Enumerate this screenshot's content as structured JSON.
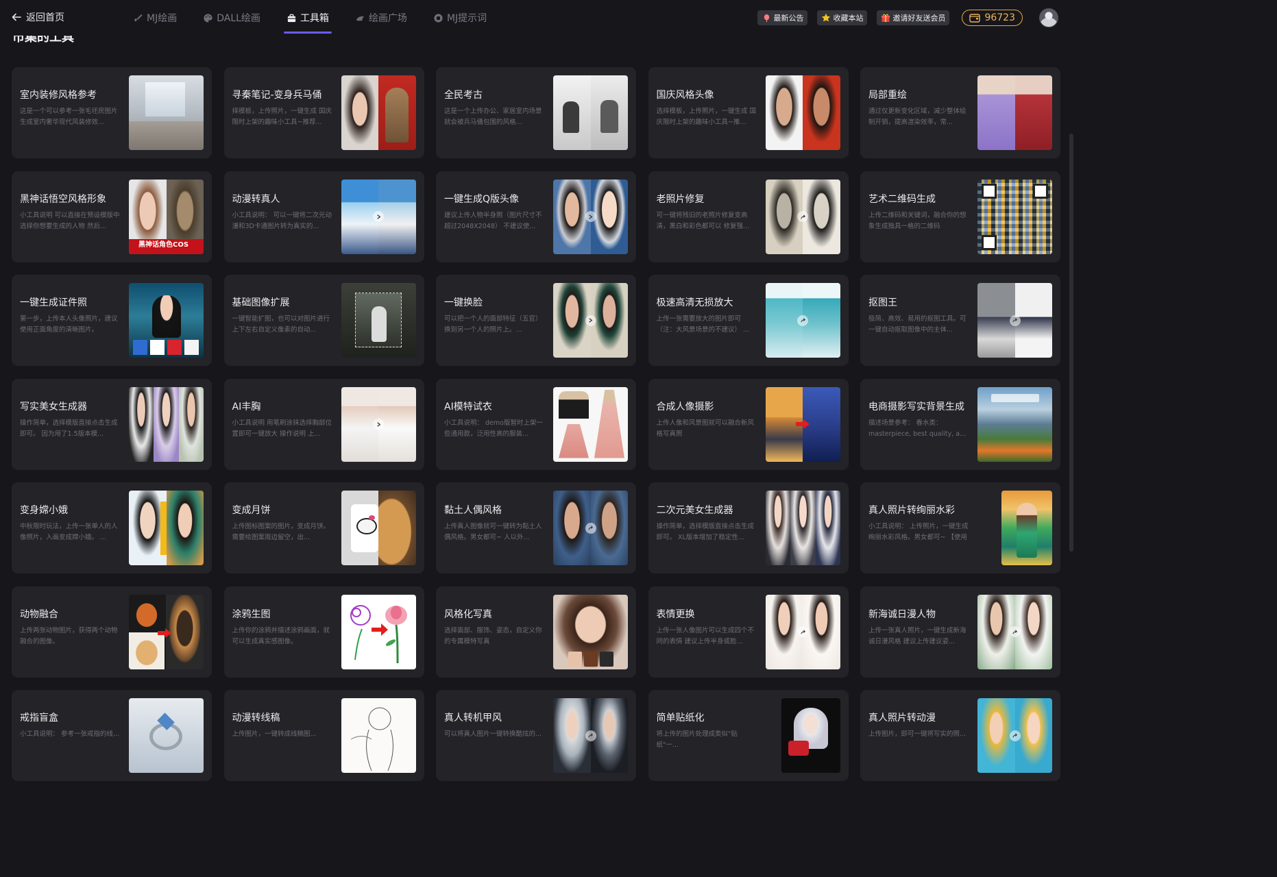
{
  "header": {
    "back_label": "返回首页",
    "nav": [
      {
        "label": "MJ绘画",
        "icon": "brush-icon",
        "active": false
      },
      {
        "label": "DALL绘画",
        "icon": "palette-icon",
        "active": false
      },
      {
        "label": "工具箱",
        "icon": "toolbox-icon",
        "active": true
      },
      {
        "label": "绘画广场",
        "icon": "plaza-icon",
        "active": false
      },
      {
        "label": "MJ提示词",
        "icon": "prompt-icon",
        "active": false
      }
    ],
    "announce_label": "最新公告",
    "favorite_label": "收藏本站",
    "invite_label": "邀请好友送会员",
    "coins": "96723",
    "colors": {
      "accent": "#6a5cf5",
      "coin": "#f0b35a",
      "background": "#17171b",
      "card": "#232328"
    }
  },
  "section_title": "市集的工具",
  "tools": [
    {
      "title": "室内装修风格参考",
      "desc": "这是一个可以参考一张毛坯房图片生成室内奢华现代风装修效..."
    },
    {
      "title": "寻秦笔记-变身兵马俑",
      "desc": "择模板，上传照片，一键生成 国庆限时上架的趣味小工具~推荐..."
    },
    {
      "title": "全民考古",
      "desc": "这是一个上传办公、家居室内场景就会被兵马俑包围的风格..."
    },
    {
      "title": "国庆风格头像",
      "desc": "选择模板，上传照片，一键生成 国庆限时上架的趣味小工具~推..."
    },
    {
      "title": "局部重绘",
      "desc": "通过仅更新变化区域，减少整体绘制开销，提高渲染效率，常..."
    },
    {
      "title": "黑神话悟空风格形象",
      "desc": "小工具说明 可以直接在预设模版中选择你想要生成的人物 然后...",
      "badge": "黑神话角色COS"
    },
    {
      "title": "动漫转真人",
      "desc": "小工具说明： 可以一键将二次元动漫和3D卡通图片转为真实的..."
    },
    {
      "title": "一键生成Q版头像",
      "desc": "建议上传人物半身照（图片尺寸不超过2048X2048） 不建议使..."
    },
    {
      "title": "老照片修复",
      "desc": "可一键将残旧的老照片修复变高清，黑白和彩色都可以 修复强..."
    },
    {
      "title": "艺术二维码生成",
      "desc": "上传二维码和关键词，融合你的想象生成独具一格的二维码"
    },
    {
      "title": "一键生成证件照",
      "desc": "第一步，上传本人头像照片，建议使用正面角度的清晰图片。"
    },
    {
      "title": "基础图像扩展",
      "desc": "一键智能扩图，也可以对图片进行上下左右自定义像素的自动..."
    },
    {
      "title": "一键换脸",
      "desc": "可以把一个人的面部特征（五官）换到另一个人的照片上。..."
    },
    {
      "title": "极速高清无损放大",
      "desc": "上传一张需要放大的图片即可（注：大风景场景的不建议） ..."
    },
    {
      "title": "抠图王",
      "desc": "极简、高效、易用的抠图工具。可一键自动抠取图像中的主体..."
    },
    {
      "title": "写实美女生成器",
      "desc": "操作简单，选择模版直接点击生成即可。 因为用了1.5版本模..."
    },
    {
      "title": "AI丰胸",
      "desc": "小工具说明 用笔刷涂抹选择胸部位置即可一键放大 操作说明 上..."
    },
    {
      "title": "AI模特试衣",
      "desc": "小工具说明： demo版暂时上架一些通用款，泛用性高的服装..."
    },
    {
      "title": "合成人像摄影",
      "desc": "上传人像和风景图就可以融合新风格写真照"
    },
    {
      "title": "电商摄影写实背景生成",
      "desc": "描述场景参考： 春水类：masterpiece, best quality, a..."
    },
    {
      "title": "变身嫦小娥",
      "desc": "中秋限时玩法，上传一张单人的人像照片，入画变成嫦小娥。 ..."
    },
    {
      "title": "变成月饼",
      "desc": "上传图标图案的图片，变成月饼。 需要给图案周边留空，出..."
    },
    {
      "title": "黏土人偶风格",
      "desc": "上传真人图像就可一键转为黏土人偶风格。男女都可~ 人以外..."
    },
    {
      "title": "二次元美女生成器",
      "desc": "操作简单，选择模版直接点击生成即可。 XL版本增加了稳定性..."
    },
    {
      "title": "真人照片转绚丽水彩",
      "desc": "小工具说明： 上传照片，一键生成绚丽水彩风格。男女都可~ 【使用建议】：..."
    },
    {
      "title": "动物融合",
      "desc": "上传两张动物图片，获得两个动物融合的图像。"
    },
    {
      "title": "涂鸦生图",
      "desc": "上传你的涂鸦并描述涂鸦画面，就可以生成真实感图像。"
    },
    {
      "title": "风格化写真",
      "desc": "选择面部、服饰、姿态，自定义你的专属模特写真"
    },
    {
      "title": "表情更换",
      "desc": "上传一张人像图片可以生成四个不同的表情 建议上传半身或脸..."
    },
    {
      "title": "新海诚日漫人物",
      "desc": "上传一张真人照片，一键生成新海诚日漫风格 建议上传建议姿..."
    },
    {
      "title": "戒指盲盒",
      "desc": "小工具说明： 参考一张戒指的线..."
    },
    {
      "title": "动漫转线稿",
      "desc": "上传图片，一键转成线稿图..."
    },
    {
      "title": "真人转机甲风",
      "desc": "可以将真人图片一键转换酷炫的..."
    },
    {
      "title": "简单贴纸化",
      "desc": "将上传的图片处理成类似\"贴纸\"一..."
    },
    {
      "title": "真人照片转动漫",
      "desc": "上传图片，即可一键将写实的照..."
    }
  ]
}
